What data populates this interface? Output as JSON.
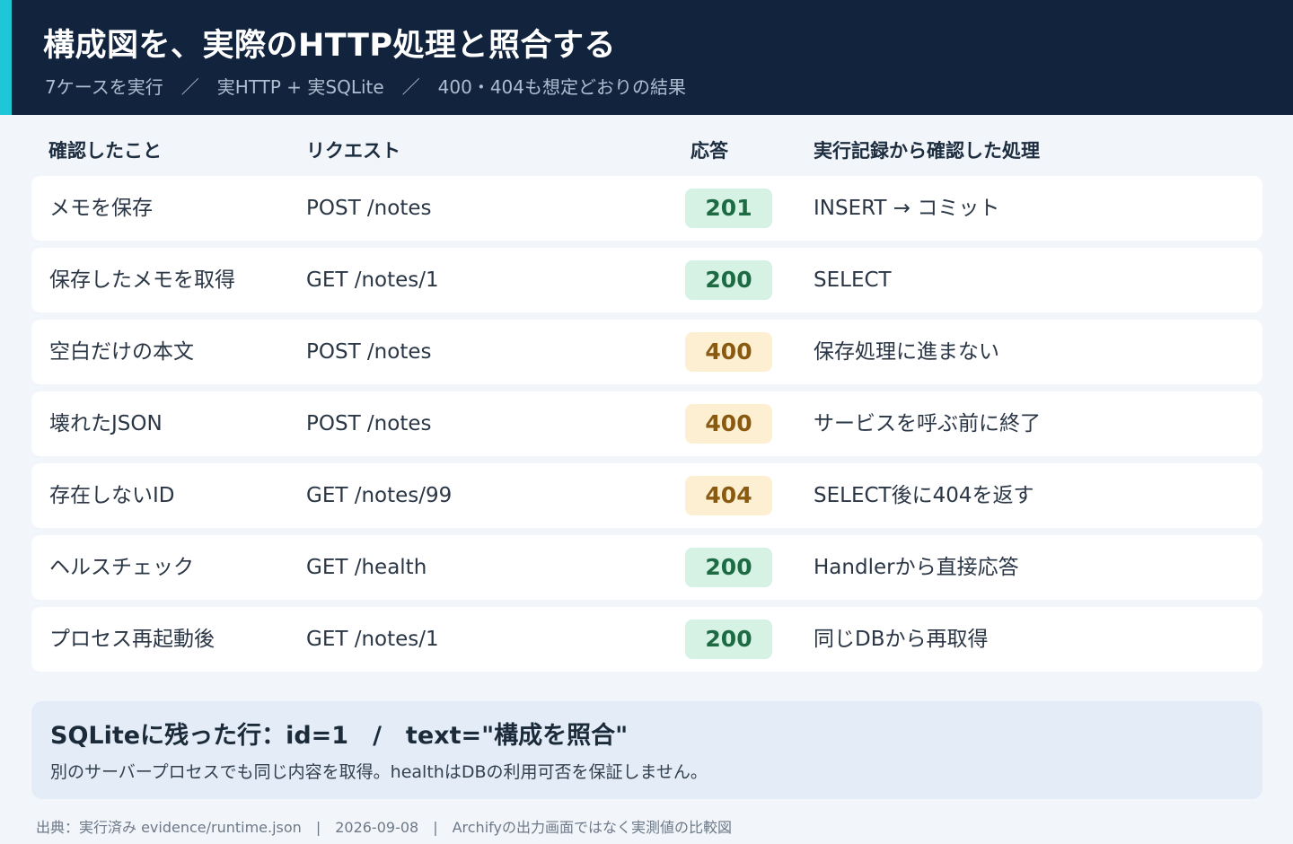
{
  "header": {
    "title": "構成図を、実際のHTTP処理と照合する",
    "subtitle": "7ケースを実行　／　実HTTP + 実SQLite　／　400・404も想定どおりの結果",
    "accent_color": "#1fc6d8",
    "background_color": "#12233d"
  },
  "table": {
    "columns": [
      "確認したこと",
      "リクエスト",
      "応答",
      "実行記録から確認した処理"
    ],
    "rows": [
      {
        "check": "メモを保存",
        "request": "POST /notes",
        "status": "201",
        "status_kind": "success",
        "process": "INSERT → コミット"
      },
      {
        "check": "保存したメモを取得",
        "request": "GET /notes/1",
        "status": "200",
        "status_kind": "success",
        "process": "SELECT"
      },
      {
        "check": "空白だけの本文",
        "request": "POST /notes",
        "status": "400",
        "status_kind": "warning",
        "process": "保存処理に進まない"
      },
      {
        "check": "壊れたJSON",
        "request": "POST /notes",
        "status": "400",
        "status_kind": "warning",
        "process": "サービスを呼ぶ前に終了"
      },
      {
        "check": "存在しないID",
        "request": "GET /notes/99",
        "status": "404",
        "status_kind": "warning",
        "process": "SELECT後に404を返す"
      },
      {
        "check": "ヘルスチェック",
        "request": "GET /health",
        "status": "200",
        "status_kind": "success",
        "process": "Handlerから直接応答"
      },
      {
        "check": "プロセス再起動後",
        "request": "GET /notes/1",
        "status": "200",
        "status_kind": "success",
        "process": "同じDBから再取得"
      }
    ]
  },
  "summary": {
    "title": "SQLiteに残った行：id=1　/　text=\"構成を照合\"",
    "description": "別のサーバープロセスでも同じ内容を取得。healthはDBの利用可否を保証しません。"
  },
  "footer": {
    "text": "出典：実行済み evidence/runtime.json　|　2026-09-08　|　Archifyの出力画面ではなく実測値の比較図"
  },
  "colors": {
    "success_bg": "#d5f2e4",
    "success_text": "#1d6b45",
    "warning_bg": "#fdefd2",
    "warning_text": "#8a5a10"
  }
}
